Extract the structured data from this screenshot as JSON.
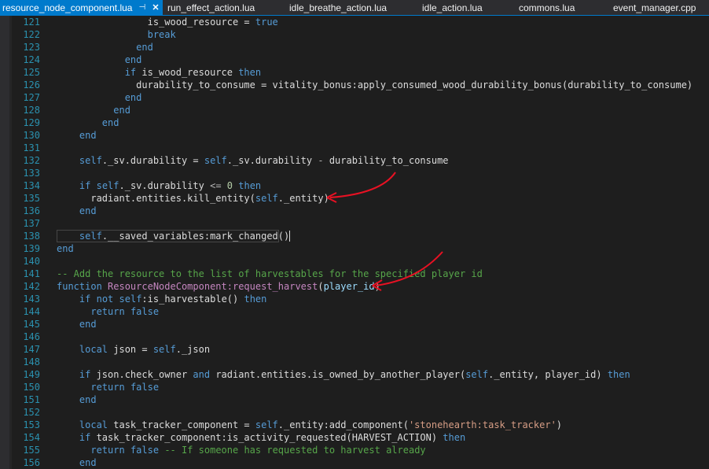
{
  "tabs": [
    {
      "label": "resource_node_component.lua",
      "active": true,
      "pin": "⊣",
      "close": "✕"
    },
    {
      "label": "run_effect_action.lua"
    },
    {
      "label": "idle_breathe_action.lua"
    },
    {
      "label": "idle_action.lua"
    },
    {
      "label": "commons.lua"
    },
    {
      "label": "event_manager.cpp"
    }
  ],
  "editor": {
    "lines": [
      {
        "n": "121",
        "tokens": [
          {
            "t": "                is_wood_resource = "
          },
          {
            "t": "true",
            "c": "kw"
          }
        ]
      },
      {
        "n": "122",
        "tokens": [
          {
            "t": "                "
          },
          {
            "t": "break",
            "c": "kw"
          }
        ]
      },
      {
        "n": "123",
        "tokens": [
          {
            "t": "              "
          },
          {
            "t": "end",
            "c": "kw"
          }
        ]
      },
      {
        "n": "124",
        "tokens": [
          {
            "t": "            "
          },
          {
            "t": "end",
            "c": "kw"
          }
        ]
      },
      {
        "n": "125",
        "tokens": [
          {
            "t": "            "
          },
          {
            "t": "if",
            "c": "kw"
          },
          {
            "t": " is_wood_resource "
          },
          {
            "t": "then",
            "c": "kw"
          }
        ]
      },
      {
        "n": "126",
        "tokens": [
          {
            "t": "              durability_to_consume = vitality_bonus:apply_consumed_wood_durability_bonus(durability_to_consume)"
          }
        ]
      },
      {
        "n": "127",
        "tokens": [
          {
            "t": "            "
          },
          {
            "t": "end",
            "c": "kw"
          }
        ]
      },
      {
        "n": "128",
        "tokens": [
          {
            "t": "          "
          },
          {
            "t": "end",
            "c": "kw"
          }
        ]
      },
      {
        "n": "129",
        "tokens": [
          {
            "t": "        "
          },
          {
            "t": "end",
            "c": "kw"
          }
        ]
      },
      {
        "n": "130",
        "tokens": [
          {
            "t": "    "
          },
          {
            "t": "end",
            "c": "kw"
          }
        ]
      },
      {
        "n": "131",
        "tokens": []
      },
      {
        "n": "132",
        "tokens": [
          {
            "t": "    "
          },
          {
            "t": "self",
            "c": "sf"
          },
          {
            "t": "._sv.durability = "
          },
          {
            "t": "self",
            "c": "sf"
          },
          {
            "t": "._sv.durability "
          },
          {
            "t": "-",
            "c": "op"
          },
          {
            "t": " durability_to_consume"
          }
        ]
      },
      {
        "n": "133",
        "tokens": []
      },
      {
        "n": "134",
        "tokens": [
          {
            "t": "    "
          },
          {
            "t": "if",
            "c": "kw"
          },
          {
            "t": " "
          },
          {
            "t": "self",
            "c": "sf"
          },
          {
            "t": "._sv.durability "
          },
          {
            "t": "<=",
            "c": "op"
          },
          {
            "t": " "
          },
          {
            "t": "0",
            "c": "nm"
          },
          {
            "t": " "
          },
          {
            "t": "then",
            "c": "kw"
          }
        ]
      },
      {
        "n": "135",
        "tokens": [
          {
            "t": "      radiant.entities.kill_entity("
          },
          {
            "t": "self",
            "c": "sf"
          },
          {
            "t": "._entity)"
          }
        ]
      },
      {
        "n": "136",
        "tokens": [
          {
            "t": "    "
          },
          {
            "t": "end",
            "c": "kw"
          }
        ]
      },
      {
        "n": "137",
        "tokens": []
      },
      {
        "n": "138",
        "tokens": [
          {
            "t": "    "
          },
          {
            "t": "self",
            "c": "sf"
          },
          {
            "t": ".__saved_variables:mark_changed()"
          }
        ],
        "current": true
      },
      {
        "n": "139",
        "tokens": [
          {
            "t": "end",
            "c": "kw"
          }
        ]
      },
      {
        "n": "140",
        "tokens": []
      },
      {
        "n": "141",
        "tokens": [
          {
            "t": "-- Add the resource to the list of harvestables for the specified player id",
            "c": "cm"
          }
        ]
      },
      {
        "n": "142",
        "tokens": [
          {
            "t": "function",
            "c": "kw"
          },
          {
            "t": " "
          },
          {
            "t": "ResourceNodeComponent:request_harvest",
            "c": "fn"
          },
          {
            "t": "("
          },
          {
            "t": "player_id",
            "c": "pl"
          },
          {
            "t": ")"
          }
        ]
      },
      {
        "n": "143",
        "tokens": [
          {
            "t": "    "
          },
          {
            "t": "if",
            "c": "kw"
          },
          {
            "t": " "
          },
          {
            "t": "not",
            "c": "kw"
          },
          {
            "t": " "
          },
          {
            "t": "self",
            "c": "sf"
          },
          {
            "t": ":is_harvestable() "
          },
          {
            "t": "then",
            "c": "kw"
          }
        ]
      },
      {
        "n": "144",
        "tokens": [
          {
            "t": "      "
          },
          {
            "t": "return",
            "c": "kw"
          },
          {
            "t": " "
          },
          {
            "t": "false",
            "c": "kw"
          }
        ]
      },
      {
        "n": "145",
        "tokens": [
          {
            "t": "    "
          },
          {
            "t": "end",
            "c": "kw"
          }
        ]
      },
      {
        "n": "146",
        "tokens": []
      },
      {
        "n": "147",
        "tokens": [
          {
            "t": "    "
          },
          {
            "t": "local",
            "c": "kw"
          },
          {
            "t": " json = "
          },
          {
            "t": "self",
            "c": "sf"
          },
          {
            "t": "._json"
          }
        ]
      },
      {
        "n": "148",
        "tokens": []
      },
      {
        "n": "149",
        "tokens": [
          {
            "t": "    "
          },
          {
            "t": "if",
            "c": "kw"
          },
          {
            "t": " json.check_owner "
          },
          {
            "t": "and",
            "c": "kw"
          },
          {
            "t": " radiant.entities.is_owned_by_another_player("
          },
          {
            "t": "self",
            "c": "sf"
          },
          {
            "t": "._entity, player_id) "
          },
          {
            "t": "then",
            "c": "kw"
          }
        ]
      },
      {
        "n": "150",
        "tokens": [
          {
            "t": "      "
          },
          {
            "t": "return",
            "c": "kw"
          },
          {
            "t": " "
          },
          {
            "t": "false",
            "c": "kw"
          }
        ]
      },
      {
        "n": "151",
        "tokens": [
          {
            "t": "    "
          },
          {
            "t": "end",
            "c": "kw"
          }
        ]
      },
      {
        "n": "152",
        "tokens": []
      },
      {
        "n": "153",
        "tokens": [
          {
            "t": "    "
          },
          {
            "t": "local",
            "c": "kw"
          },
          {
            "t": " task_tracker_component = "
          },
          {
            "t": "self",
            "c": "sf"
          },
          {
            "t": "._entity:add_component("
          },
          {
            "t": "'stonehearth:task_tracker'",
            "c": "st"
          },
          {
            "t": ")"
          }
        ]
      },
      {
        "n": "154",
        "tokens": [
          {
            "t": "    "
          },
          {
            "t": "if",
            "c": "kw"
          },
          {
            "t": " task_tracker_component:is_activity_requested(HARVEST_ACTION) "
          },
          {
            "t": "then",
            "c": "kw"
          }
        ]
      },
      {
        "n": "155",
        "tokens": [
          {
            "t": "      "
          },
          {
            "t": "return",
            "c": "kw"
          },
          {
            "t": " "
          },
          {
            "t": "false",
            "c": "kw"
          },
          {
            "t": " "
          },
          {
            "t": "-- If someone has requested to harvest already",
            "c": "cm"
          }
        ]
      },
      {
        "n": "156",
        "tokens": [
          {
            "t": "    "
          },
          {
            "t": "end",
            "c": "kw"
          }
        ]
      }
    ]
  },
  "annotation_color": "#e81123"
}
